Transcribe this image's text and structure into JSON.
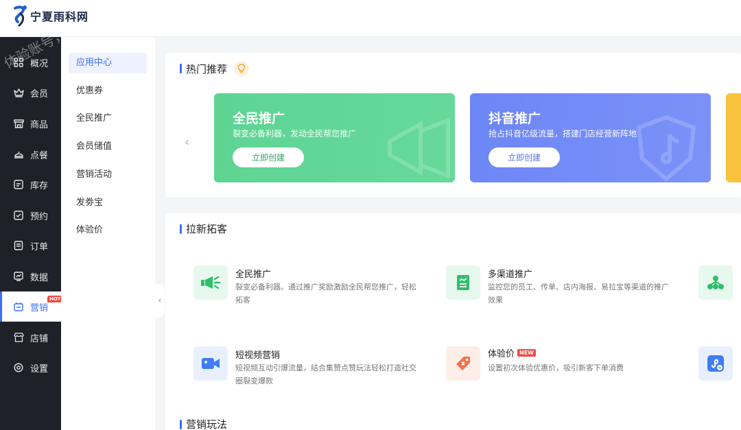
{
  "header": {
    "brand": "宁夏雨科网"
  },
  "watermark": "体验账号，",
  "sidebar": {
    "items": [
      {
        "label": "概况",
        "icon": "grid-icon"
      },
      {
        "label": "会员",
        "icon": "crown-icon"
      },
      {
        "label": "商品",
        "icon": "store-icon"
      },
      {
        "label": "点餐",
        "icon": "dish-icon"
      },
      {
        "label": "库存",
        "icon": "inventory-icon"
      },
      {
        "label": "预约",
        "icon": "calendar-check-icon"
      },
      {
        "label": "订单",
        "icon": "order-icon"
      },
      {
        "label": "数据",
        "icon": "chart-icon"
      },
      {
        "label": "营销",
        "icon": "marketing-icon",
        "badge": "HOT",
        "active": true
      },
      {
        "label": "店铺",
        "icon": "shop-icon"
      },
      {
        "label": "设置",
        "icon": "settings-icon"
      }
    ]
  },
  "submenu": {
    "items": [
      "应用中心",
      "优惠券",
      "全民推广",
      "会员储值",
      "营销活动",
      "发劵宝",
      "体验价"
    ]
  },
  "hot": {
    "title": "热门推荐",
    "cards": [
      {
        "title": "全民推广",
        "desc": "裂变必备利器，发动全民帮您推广",
        "button": "立即创建",
        "color": "#5ed493"
      },
      {
        "title": "抖音推广",
        "desc": "抢占抖音亿级流量，搭建门店经营新阵地",
        "button": "立即创建",
        "color": "#6f88f7"
      }
    ]
  },
  "acquire": {
    "title": "拉新拓客",
    "items": [
      {
        "title": "全民推广",
        "desc": "裂变必备利器。通过推广奖励激励全民帮您推广，轻松拓客",
        "icon": "megaphone-icon"
      },
      {
        "title": "多渠道推广",
        "desc": "监控您的员工、传单、店内海报、易拉宝等渠道的推广效果",
        "icon": "report-icon"
      },
      {
        "title": "短视频营销",
        "desc": "短视频互动引爆流量，结合集赞点赞玩法轻松打造社交圈裂变爆款",
        "icon": "video-icon"
      },
      {
        "title": "体验价",
        "badge": "NEW",
        "desc": "设置初次体验优惠价，吸引新客下单消费",
        "icon": "price-tag-icon"
      }
    ]
  },
  "play": {
    "title": "营销玩法"
  }
}
